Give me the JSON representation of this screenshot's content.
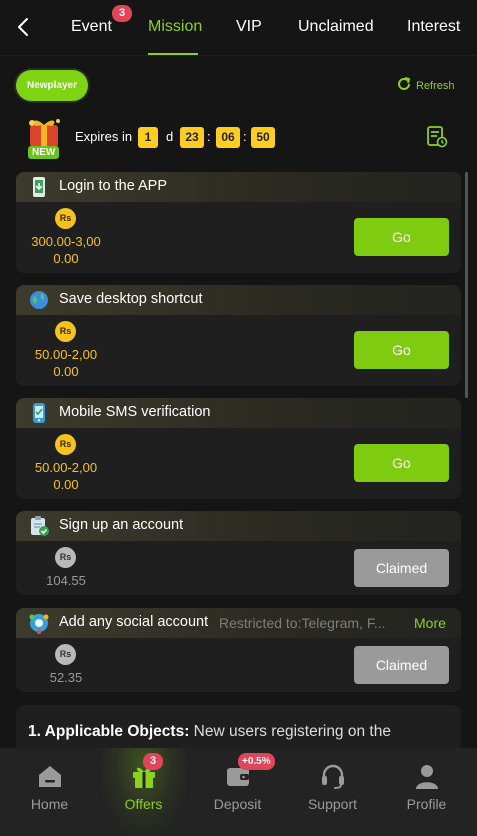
{
  "tabs": [
    {
      "label": "Event",
      "badge": "3"
    },
    {
      "label": "Mission"
    },
    {
      "label": "VIP"
    },
    {
      "label": "Unclaimed"
    },
    {
      "label": "Interest"
    }
  ],
  "newplayer_label": "Newplayer",
  "refresh_label": "Refresh",
  "gift_badge": "NEW",
  "expires": {
    "label": "Expires in",
    "days": "1",
    "day_unit": "d",
    "hours": "23",
    "minutes": "06",
    "seconds": "50",
    "sep": ":"
  },
  "currency": "Rs",
  "tasks": [
    {
      "title": "Login to the APP",
      "reward_range": "300.00-3,00",
      "reward_value": "0.00",
      "button": "Go",
      "icon": "app-download-icon"
    },
    {
      "title": "Save desktop shortcut",
      "reward_range": "50.00-2,00",
      "reward_value": "0.00",
      "button": "Go",
      "icon": "globe-icon"
    },
    {
      "title": "Mobile SMS verification",
      "reward_range": "50.00-2,00",
      "reward_value": "0.00",
      "button": "Go",
      "icon": "phone-icon"
    },
    {
      "title": "Sign up an account",
      "reward_value": "104.55",
      "button": "Claimed",
      "icon": "clipboard-check-icon"
    },
    {
      "title": "Add any social account",
      "restriction": "Restricted to:Telegram, F...",
      "more": "More",
      "reward_value": "52.35",
      "button": "Claimed",
      "icon": "social-icon"
    }
  ],
  "rules": {
    "heading": "1. Applicable Objects:",
    "text": " New users registering on the"
  },
  "nav": [
    {
      "label": "Home",
      "icon": "home-icon"
    },
    {
      "label": "Offers",
      "icon": "gift-icon",
      "badge": "3"
    },
    {
      "label": "Deposit",
      "icon": "wallet-icon",
      "badge": "+0.5%"
    },
    {
      "label": "Support",
      "icon": "headset-icon"
    },
    {
      "label": "Profile",
      "icon": "user-icon"
    }
  ],
  "colors": {
    "accent": "#8cd11e",
    "gold": "#f6c21b",
    "badge": "#e0455a",
    "background": "#151515"
  }
}
